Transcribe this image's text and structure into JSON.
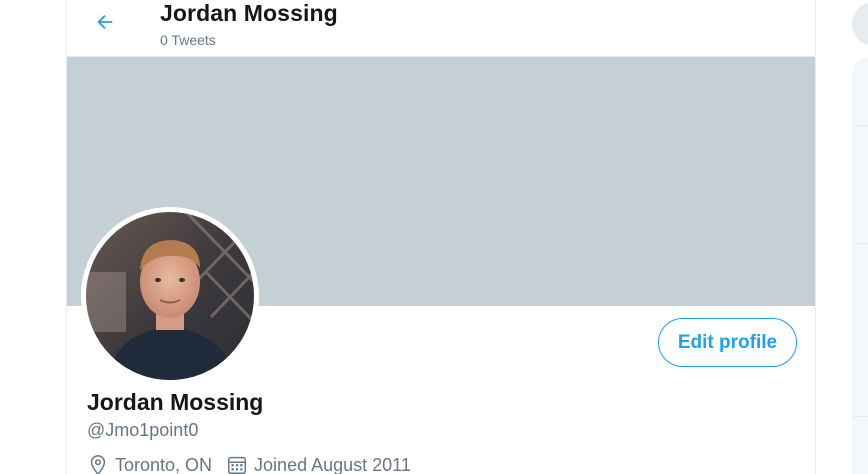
{
  "header": {
    "title": "Jordan Mossing",
    "tweet_count": "0 Tweets"
  },
  "profile": {
    "name": "Jordan Mossing",
    "handle": "@Jmo1point0",
    "location": "Toronto, ON",
    "joined": "Joined August 2011",
    "edit_label": "Edit profile"
  },
  "icons": {
    "back": "arrow-left-icon",
    "location": "location-pin-icon",
    "calendar": "calendar-icon"
  },
  "colors": {
    "accent": "#1da1f2",
    "banner": "#c4cfd6",
    "text_primary": "#14171a",
    "text_secondary": "#657786"
  }
}
